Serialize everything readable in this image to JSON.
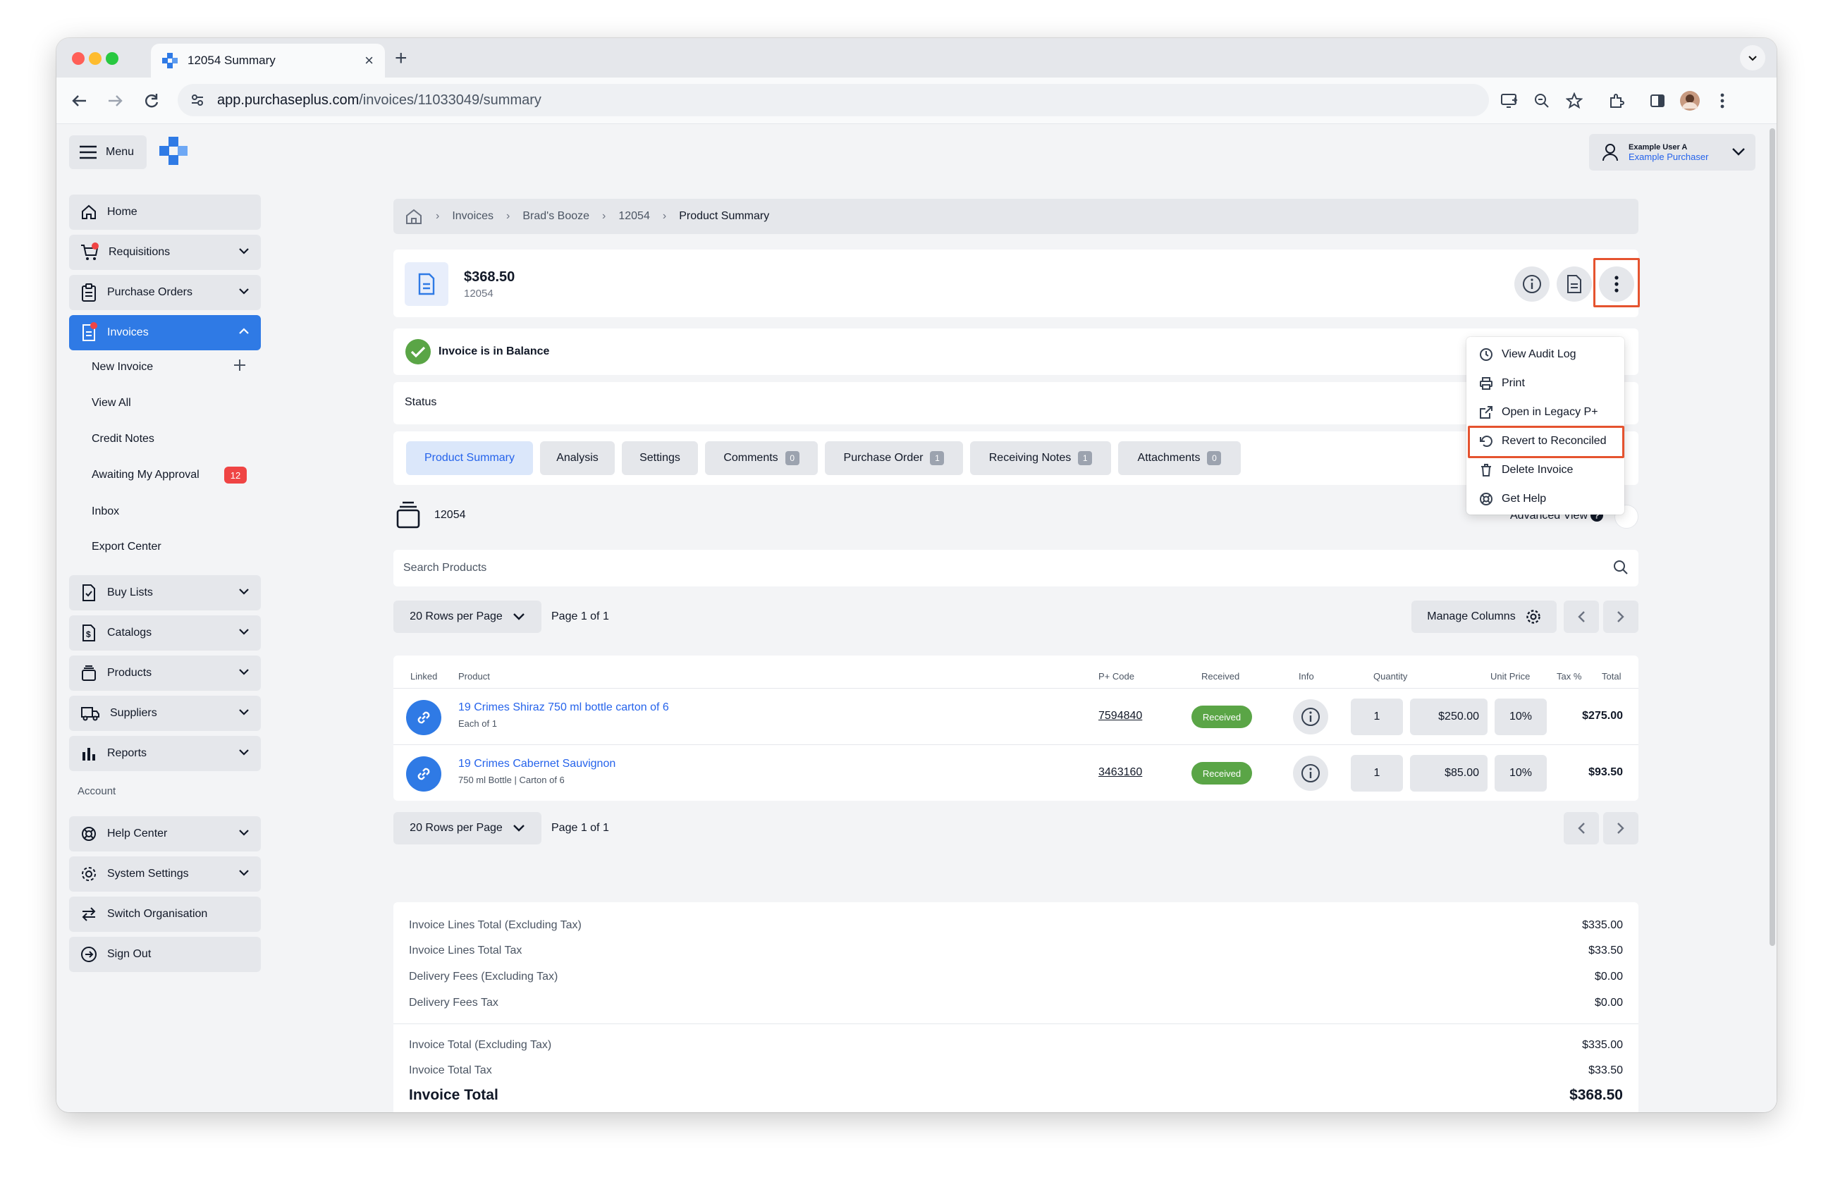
{
  "browser": {
    "tab_title": "12054 Summary",
    "url_host": "app.purchaseplus.com",
    "url_path": "/invoices/11033049/summary"
  },
  "header": {
    "menu_label": "Menu",
    "user_name": "Example User A",
    "user_role": "Example Purchaser"
  },
  "sidebar": {
    "items": [
      {
        "label": "Home"
      },
      {
        "label": "Requisitions"
      },
      {
        "label": "Purchase Orders"
      },
      {
        "label": "Invoices"
      },
      {
        "label": "Buy Lists"
      },
      {
        "label": "Catalogs"
      },
      {
        "label": "Products"
      },
      {
        "label": "Suppliers"
      },
      {
        "label": "Reports"
      }
    ],
    "invoice_sub": [
      {
        "label": "New Invoice"
      },
      {
        "label": "View All"
      },
      {
        "label": "Credit Notes"
      },
      {
        "label": "Awaiting My Approval",
        "badge": "12"
      },
      {
        "label": "Inbox"
      },
      {
        "label": "Export Center"
      }
    ],
    "account_label": "Account",
    "account_items": [
      {
        "label": "Help Center"
      },
      {
        "label": "System Settings"
      },
      {
        "label": "Switch Organisation"
      },
      {
        "label": "Sign Out"
      }
    ]
  },
  "breadcrumb": [
    "Invoices",
    "Brad's Booze",
    "12054",
    "Product Summary"
  ],
  "invoice": {
    "amount": "$368.50",
    "number": "12054",
    "balance_text": "Invoice is in Balance",
    "status_label": "Status"
  },
  "actions_menu": [
    {
      "label": "View Audit Log",
      "icon": "clock-icon"
    },
    {
      "label": "Print",
      "icon": "printer-icon"
    },
    {
      "label": "Open in Legacy P+",
      "icon": "external-link-icon"
    },
    {
      "label": "Revert to Reconciled",
      "icon": "revert-icon"
    },
    {
      "label": "Delete Invoice",
      "icon": "trash-icon"
    },
    {
      "label": "Get Help",
      "icon": "lifebuoy-icon"
    }
  ],
  "tabs": [
    {
      "label": "Product Summary"
    },
    {
      "label": "Analysis"
    },
    {
      "label": "Settings"
    },
    {
      "label": "Comments",
      "count": "0"
    },
    {
      "label": "Purchase Order",
      "count": "1"
    },
    {
      "label": "Receiving Notes",
      "count": "1"
    },
    {
      "label": "Attachments",
      "count": "0"
    }
  ],
  "products_section": {
    "title": "12054",
    "advanced_view": "Advanced View",
    "search_placeholder": "Search Products",
    "rows_per_page": "20 Rows per Page",
    "page_info": "Page 1 of 1",
    "manage_columns": "Manage Columns"
  },
  "table": {
    "columns": [
      "Linked",
      "Product",
      "P+ Code",
      "Received",
      "Info",
      "Quantity",
      "Unit Price",
      "Tax %",
      "Total"
    ],
    "rows": [
      {
        "product": "19 Crimes Shiraz 750 ml bottle carton of 6",
        "sub": "Each of 1",
        "code": "7594840",
        "received": "Received",
        "quantity": "1",
        "unit_price": "$250.00",
        "tax": "10%",
        "total": "$275.00"
      },
      {
        "product": "19 Crimes Cabernet Sauvignon",
        "sub": "750 ml Bottle | Carton of 6",
        "code": "3463160",
        "received": "Received",
        "quantity": "1",
        "unit_price": "$85.00",
        "tax": "10%",
        "total": "$93.50"
      }
    ]
  },
  "totals": {
    "lines": [
      {
        "label": "Invoice Lines Total (Excluding Tax)",
        "value": "$335.00"
      },
      {
        "label": "Invoice Lines Total Tax",
        "value": "$33.50"
      },
      {
        "label": "Delivery Fees (Excluding Tax)",
        "value": "$0.00"
      },
      {
        "label": "Delivery Fees Tax",
        "value": "$0.00"
      },
      {
        "label": "Invoice Total (Excluding Tax)",
        "value": "$335.00"
      },
      {
        "label": "Invoice Total Tax",
        "value": "$33.50"
      }
    ],
    "grand_label": "Invoice Total",
    "grand_value": "$368.50"
  },
  "colors": {
    "accent": "#2f7ae5",
    "received": "#5aa546",
    "highlight": "#e5532f",
    "alert": "#ef4444"
  }
}
